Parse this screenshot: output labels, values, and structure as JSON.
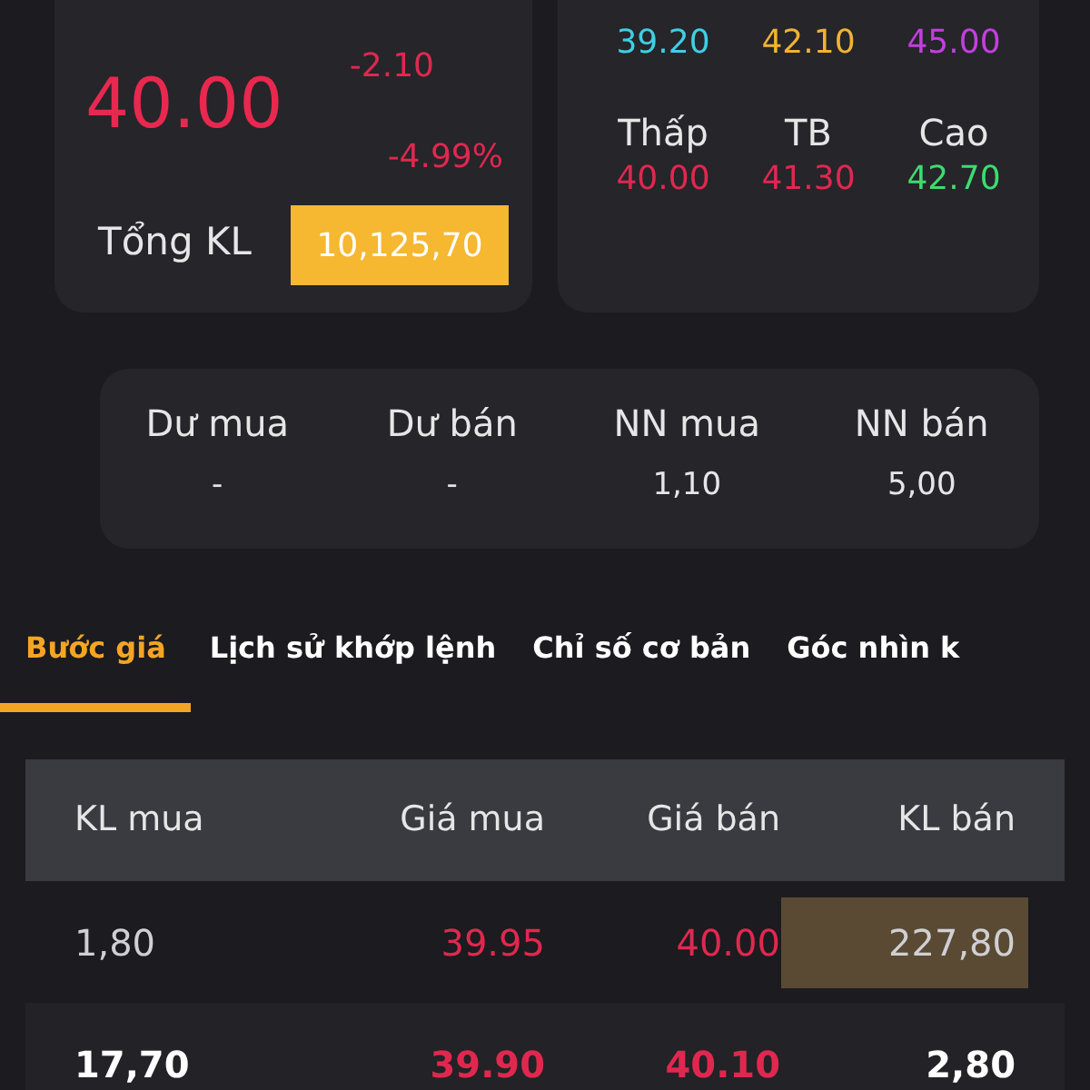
{
  "price_card": {
    "price": "40.00",
    "change": "-2.10",
    "change_percent": "-4.99%",
    "volume_label": "Tổng KL",
    "volume": "10,125,70"
  },
  "range_card": {
    "top_values": [
      {
        "value": "39.20",
        "color": "#3fcfe4"
      },
      {
        "value": "42.10",
        "color": "#f2b233"
      },
      {
        "value": "45.00",
        "color": "#c53ee0"
      }
    ],
    "stats": [
      {
        "label": "Thấp",
        "value": "40.00",
        "color": "#e0284f"
      },
      {
        "label": "TB",
        "value": "41.30",
        "color": "#e0284f"
      },
      {
        "label": "Cao",
        "value": "42.70",
        "color": "#3ddc6e"
      }
    ]
  },
  "foreign_card": [
    {
      "label": "Dư mua",
      "value": "-"
    },
    {
      "label": "Dư bán",
      "value": "-"
    },
    {
      "label": "NN mua",
      "value": "1,10"
    },
    {
      "label": "NN bán",
      "value": "5,00"
    }
  ],
  "tabs": [
    {
      "label": "Bước giá",
      "selected": true
    },
    {
      "label": "Lịch sử khớp lệnh",
      "selected": false
    },
    {
      "label": "Chỉ số cơ bản",
      "selected": false
    },
    {
      "label": "Góc nhìn k",
      "selected": false
    }
  ],
  "table": {
    "columns": [
      "KL mua",
      "Giá mua",
      "Giá bán",
      "KL bán"
    ],
    "rows": [
      {
        "emphasized": false,
        "cells": [
          {
            "text": "1,80",
            "highlighted": false
          },
          {
            "text": "39.95",
            "highlighted": false
          },
          {
            "text": "40.00",
            "highlighted": false
          },
          {
            "text": "227,80",
            "highlighted": true
          }
        ]
      },
      {
        "emphasized": true,
        "cells": [
          {
            "text": "17,70",
            "highlighted": false
          },
          {
            "text": "39.90",
            "highlighted": false
          },
          {
            "text": "40.10",
            "highlighted": false
          },
          {
            "text": "2,80",
            "highlighted": false
          }
        ]
      }
    ]
  }
}
